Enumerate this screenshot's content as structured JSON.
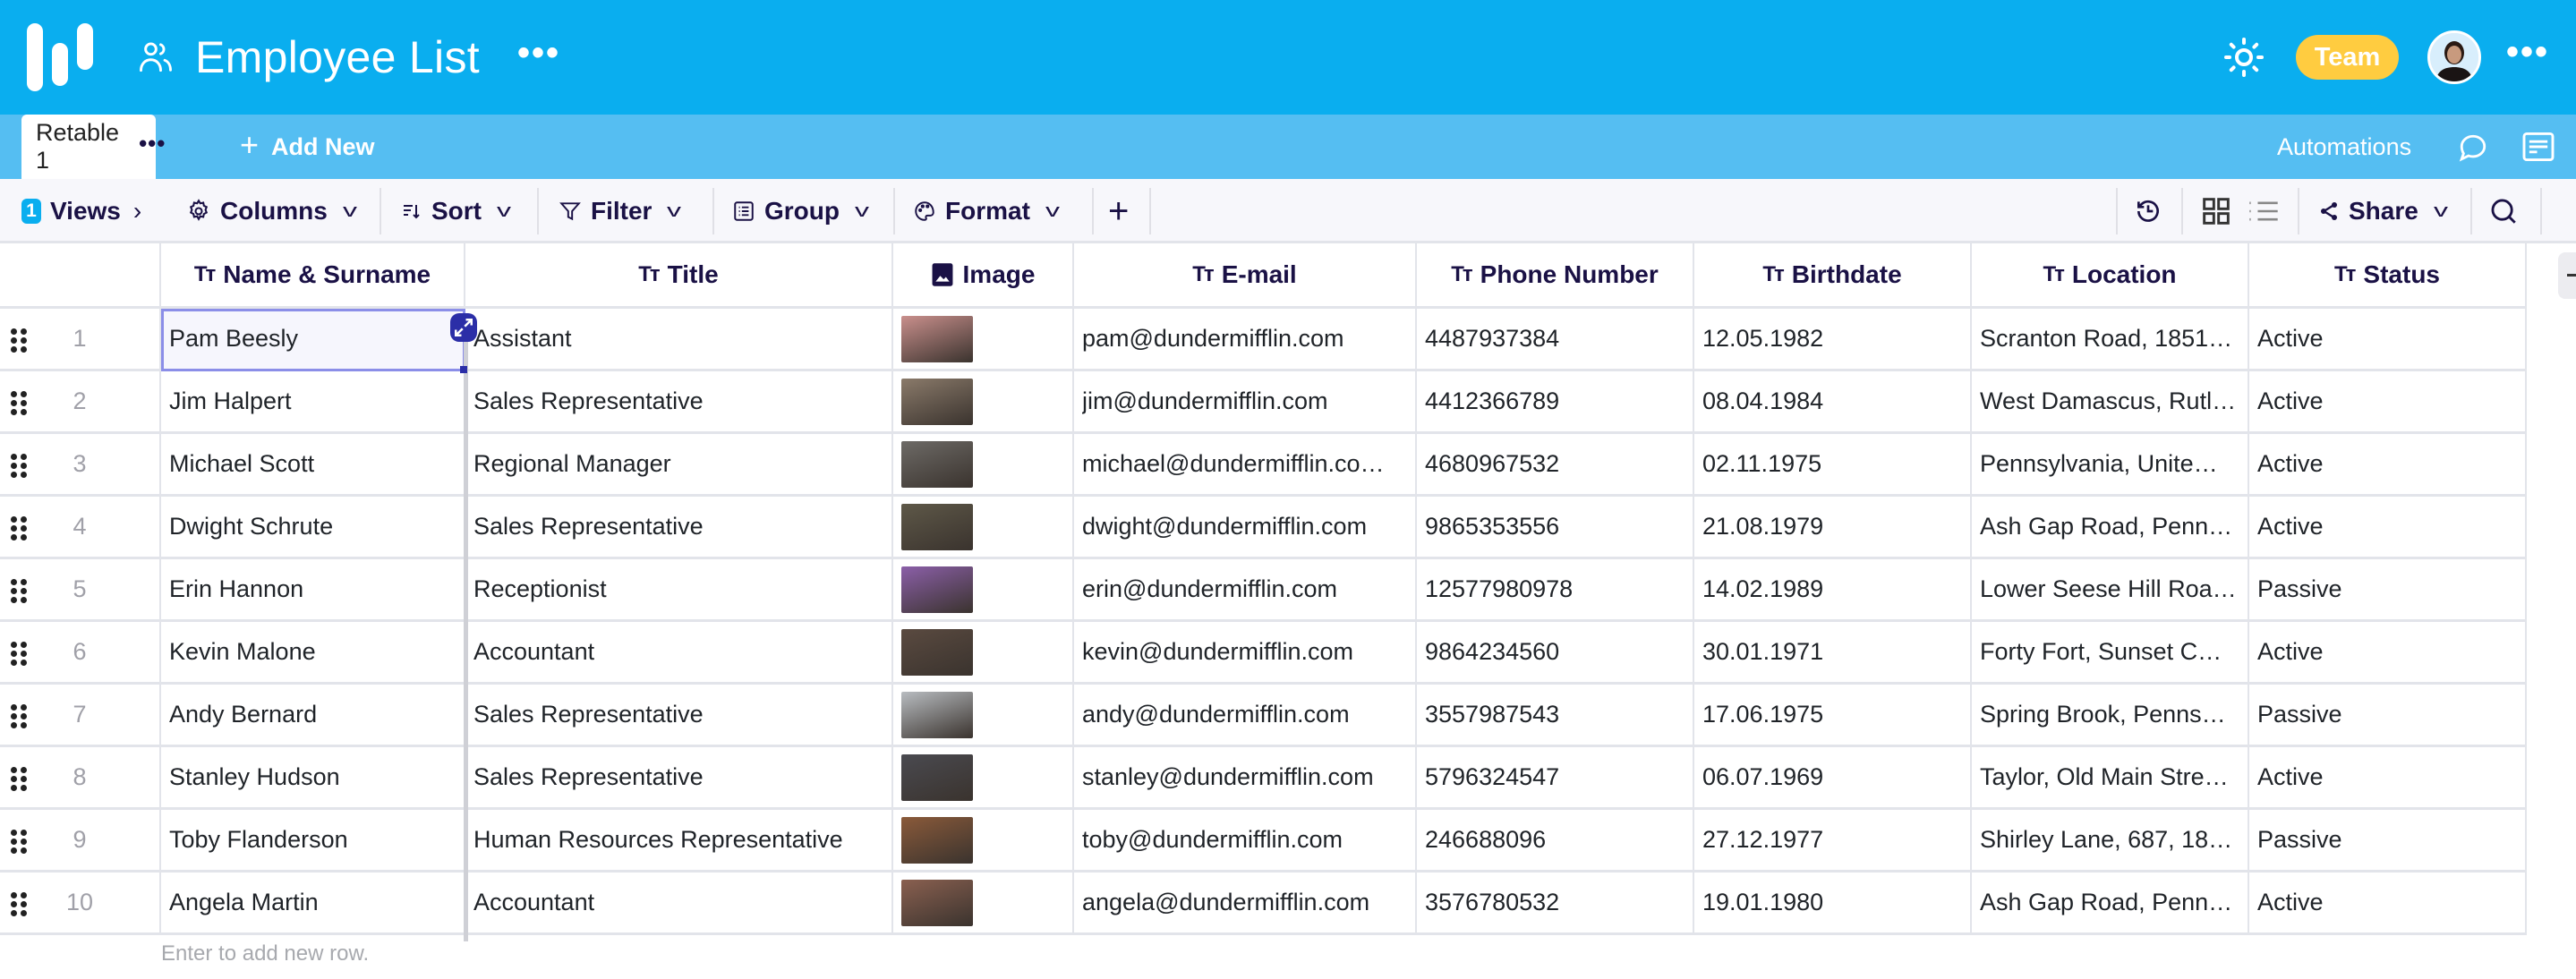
{
  "header": {
    "title": "Employee List",
    "title_icon": "people-icon",
    "more": "•••",
    "team_badge": "Team",
    "theme_icon": "sun-icon",
    "brand": {
      "primary": "#0aaeef",
      "tabbar": "#55bef2",
      "badge": "#ffcc40",
      "ink": "#1a1145"
    }
  },
  "tabs": {
    "active": {
      "label": "Retable 1",
      "more": "•••"
    },
    "add_new": "Add New",
    "automations": "Automations"
  },
  "toolbar": {
    "views_count": "1",
    "views": "Views",
    "columns": "Columns",
    "sort": "Sort",
    "filter": "Filter",
    "group": "Group",
    "format": "Format",
    "share": "Share"
  },
  "table": {
    "columns": [
      {
        "label": "Name & Surname",
        "type_icon": "text-type-icon"
      },
      {
        "label": "Title",
        "type_icon": "text-type-icon"
      },
      {
        "label": "Image",
        "type_icon": "image-type-icon"
      },
      {
        "label": "E-mail",
        "type_icon": "text-type-icon"
      },
      {
        "label": "Phone Number",
        "type_icon": "text-type-icon"
      },
      {
        "label": "Birthdate",
        "type_icon": "text-type-icon"
      },
      {
        "label": "Location",
        "type_icon": "text-type-icon"
      },
      {
        "label": "Status",
        "type_icon": "text-type-icon"
      }
    ],
    "type_glyph": "Tт",
    "rows": [
      {
        "num": "1",
        "name": "Pam Beesly",
        "title": "Assistant",
        "email": "pam@dundermifflin.com",
        "phone": "4487937384",
        "birthdate": "12.05.1982",
        "location": "Scranton Road, 1851…",
        "status": "Active"
      },
      {
        "num": "2",
        "name": "Jim Halpert",
        "title": "Sales Representative",
        "email": "jim@dundermifflin.com",
        "phone": "4412366789",
        "birthdate": "08.04.1984",
        "location": "West Damascus, Rutl…",
        "status": "Active"
      },
      {
        "num": "3",
        "name": "Michael Scott",
        "title": "Regional Manager",
        "email": "michael@dundermifflin.co…",
        "phone": "4680967532",
        "birthdate": "02.11.1975",
        "location": "Pennsylvania, Unite…",
        "status": "Active"
      },
      {
        "num": "4",
        "name": "Dwight Schrute",
        "title": "Sales Representative",
        "email": "dwight@dundermifflin.com",
        "phone": "9865353556",
        "birthdate": "21.08.1979",
        "location": "Ash Gap Road, Penn…",
        "status": "Active"
      },
      {
        "num": "5",
        "name": "Erin Hannon",
        "title": "Receptionist",
        "email": "erin@dundermifflin.com",
        "phone": "12577980978",
        "birthdate": "14.02.1989",
        "location": "Lower Seese Hill Roa…",
        "status": "Passive"
      },
      {
        "num": "6",
        "name": "Kevin Malone",
        "title": "Accountant",
        "email": "kevin@dundermifflin.com",
        "phone": "9864234560",
        "birthdate": "30.01.1971",
        "location": "Forty Fort, Sunset C…",
        "status": "Active"
      },
      {
        "num": "7",
        "name": "Andy Bernard",
        "title": "Sales Representative",
        "email": "andy@dundermifflin.com",
        "phone": "3557987543",
        "birthdate": "17.06.1975",
        "location": "Spring Brook, Penns…",
        "status": "Passive"
      },
      {
        "num": "8",
        "name": "Stanley Hudson",
        "title": "Sales Representative",
        "email": "stanley@dundermifflin.com",
        "phone": "5796324547",
        "birthdate": "06.07.1969",
        "location": "Taylor, Old Main Stre…",
        "status": "Active"
      },
      {
        "num": "9",
        "name": "Toby Flanderson",
        "title": "Human Resources Representative",
        "email": "toby@dundermifflin.com",
        "phone": "246688096",
        "birthdate": "27.12.1977",
        "location": "Shirley Lane, 687, 18…",
        "status": "Passive"
      },
      {
        "num": "10",
        "name": "Angela Martin",
        "title": "Accountant",
        "email": "angela@dundermifflin.com",
        "phone": "3576780532",
        "birthdate": "19.01.1980",
        "location": "Ash Gap Road, Penn…",
        "status": "Active"
      }
    ],
    "thumb_colors": [
      "#c98f8c",
      "#8a7a6a",
      "#6d6a66",
      "#5e5848",
      "#8b5fa8",
      "#5a4a40",
      "#b8bcc0",
      "#4a4a50",
      "#8a5a3a",
      "#8a6050"
    ],
    "add_row_hint": "Enter to add new row."
  }
}
